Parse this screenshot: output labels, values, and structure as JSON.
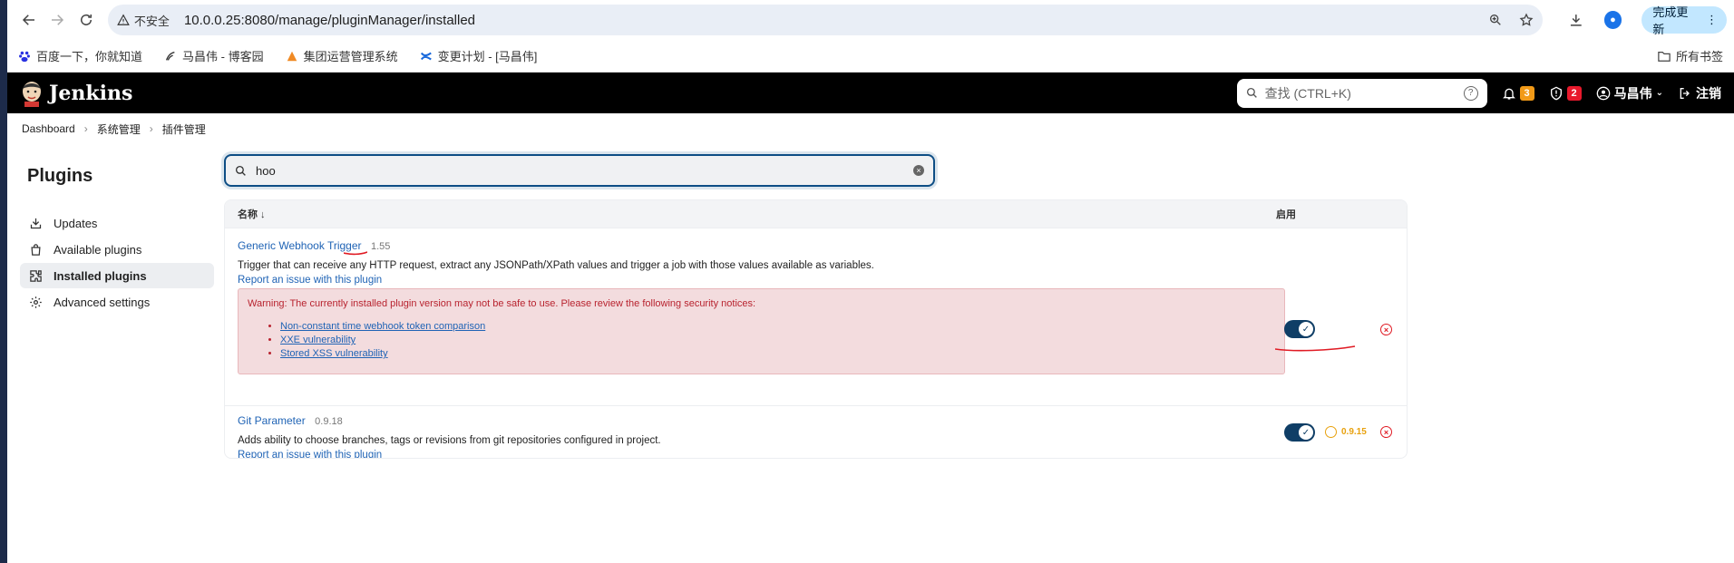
{
  "browser": {
    "insecure_label": "不安全",
    "url": "10.0.0.25:8080/manage/pluginManager/installed",
    "update_button": "完成更新"
  },
  "bookmarks": {
    "items": [
      {
        "label": "百度一下，你就知道"
      },
      {
        "label": "马昌伟 - 博客园"
      },
      {
        "label": "集团运营管理系统"
      },
      {
        "label": "变更计划 - [马昌伟]"
      }
    ],
    "all_label": "所有书签"
  },
  "jenkins": {
    "logo": "Jenkins",
    "search_placeholder": "查找 (CTRL+K)",
    "notifications_count": "3",
    "security_count": "2",
    "user": "马昌伟",
    "logout": "注销"
  },
  "breadcrumb": [
    "Dashboard",
    "系统管理",
    "插件管理"
  ],
  "sidebar": {
    "title": "Plugins",
    "items": [
      {
        "label": "Updates",
        "active": false
      },
      {
        "label": "Available plugins",
        "active": false
      },
      {
        "label": "Installed plugins",
        "active": true
      },
      {
        "label": "Advanced settings",
        "active": false
      }
    ]
  },
  "search": {
    "value": "hoo"
  },
  "table": {
    "col_name": "名称 ↓",
    "col_enabled": "启用",
    "plugins": [
      {
        "name": "Generic Webhook Trigger",
        "version": "1.55",
        "description": "Trigger that can receive any HTTP request, extract any JSONPath/XPath values and trigger a job with those values available as variables.",
        "report": "Report an issue with this plugin",
        "warning": "Warning: The currently installed plugin version may not be safe to use. Please review the following security notices:",
        "notices": [
          "Non-constant time webhook token comparison",
          "XXE vulnerability",
          "Stored XSS vulnerability"
        ],
        "enabled": true
      },
      {
        "name": "Git Parameter",
        "version": "0.9.18",
        "description": "Adds ability to choose branches, tags or revisions from git repositories configured in project.",
        "report": "Report an issue with this plugin",
        "downgrade_version": "0.9.15",
        "enabled": true
      }
    ]
  },
  "colors": {
    "accent": "#0f3e66",
    "link": "#1f63b5",
    "warning_bg": "#f3dcde",
    "danger": "#e01b24",
    "annotation": "#e01b24"
  }
}
